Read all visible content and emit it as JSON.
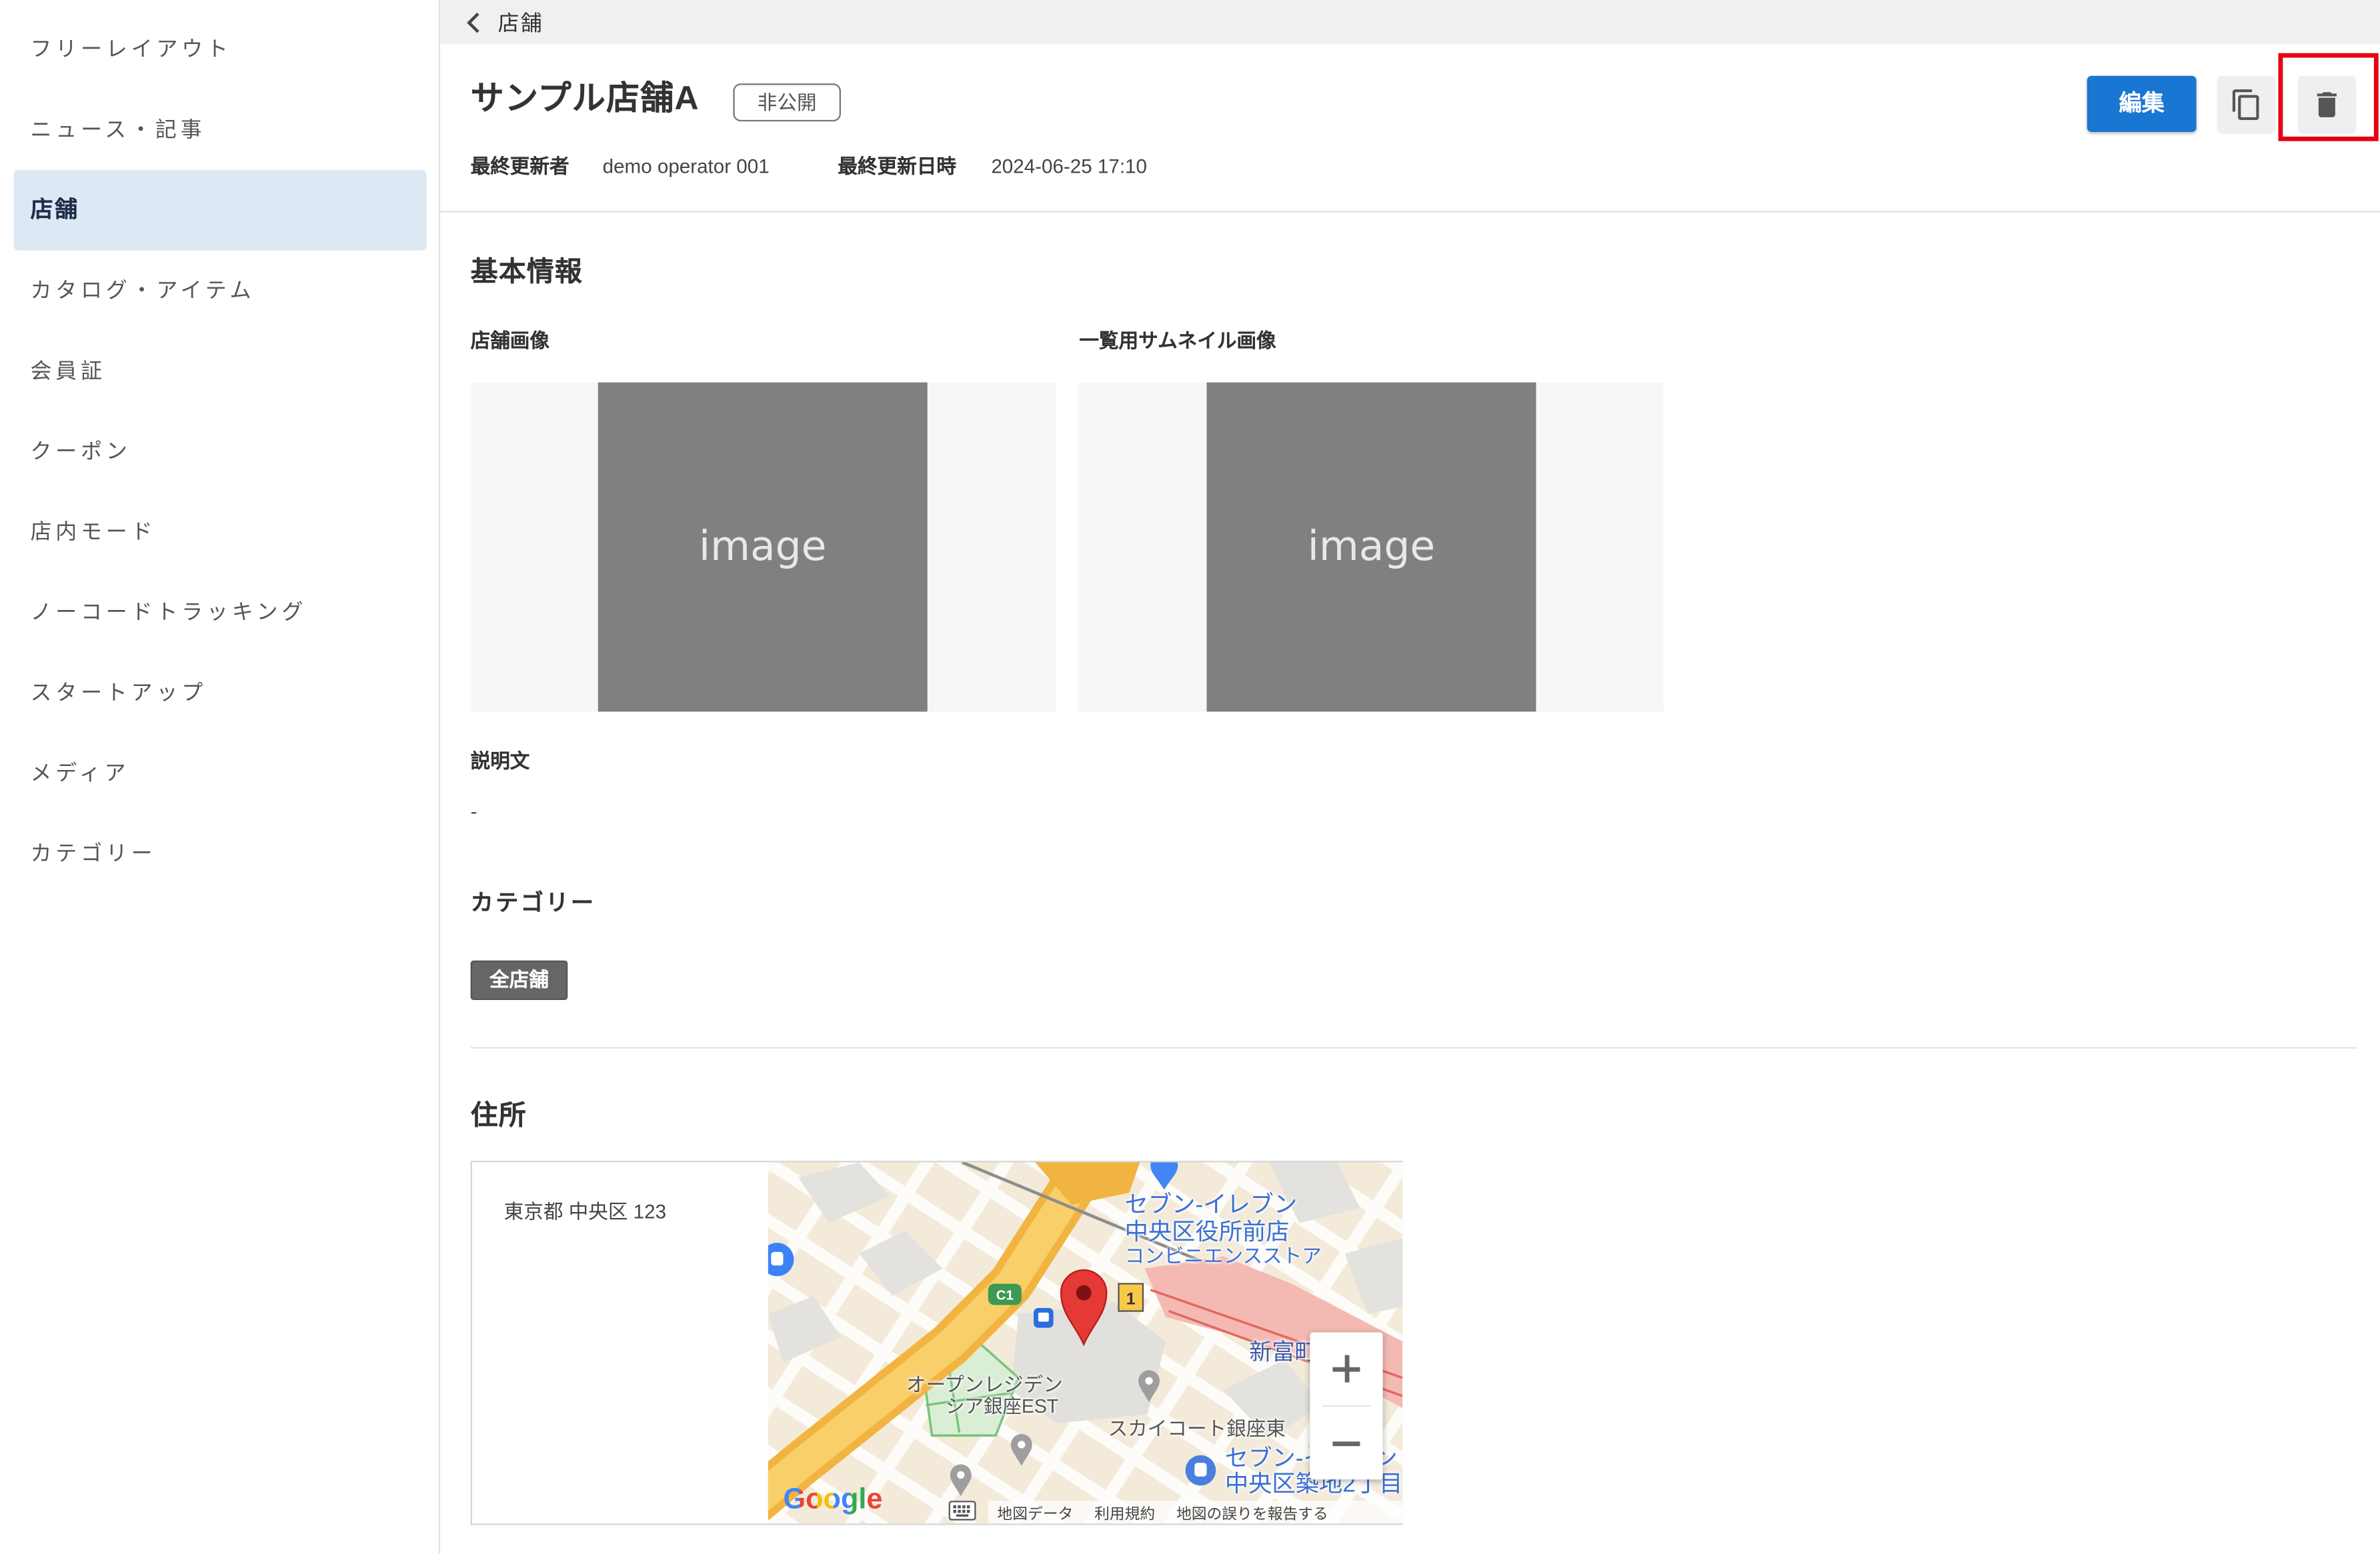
{
  "sidebar": {
    "items": [
      "フリーレイアウト",
      "ニュース・記事",
      "店舗",
      "カタログ・アイテム",
      "会員証",
      "クーポン",
      "店内モード",
      "ノーコードトラッキング",
      "スタートアップ",
      "メディア",
      "カテゴリー"
    ],
    "active_index": 2
  },
  "breadcrumb": {
    "back_label": "店舗",
    "icon": "chevron-left-icon"
  },
  "header": {
    "title": "サンプル店舗A",
    "status_badge": "非公開",
    "updated_by_label": "最終更新者",
    "updated_by": "demo operator 001",
    "updated_at_label": "最終更新日時",
    "updated_at": "2024-06-25 17:10",
    "actions": {
      "edit_label": "編集",
      "copy_icon": "copy-icon",
      "delete_icon": "trash-icon"
    }
  },
  "basic_info": {
    "heading": "基本情報",
    "store_image": {
      "label": "店舗画像",
      "placeholder": "image"
    },
    "thumbnail_image": {
      "label": "一覧用サムネイル画像",
      "placeholder": "image"
    },
    "description": {
      "label": "説明文",
      "value": "-"
    }
  },
  "category": {
    "heading": "カテゴリー",
    "tags": [
      "全店舗"
    ]
  },
  "address": {
    "heading": "住所",
    "value": "東京都 中央区 123",
    "map": {
      "labels": {
        "poi_1_name": "セブン-イレブン",
        "poi_1_branch": "中央区役所前店",
        "poi_1_type": "コンビニエンスストア",
        "station": "新富町",
        "poi_2_line1": "オープンレジデン",
        "poi_2_line2": "シア銀座EST",
        "poi_3_name": "スカイコート銀座東",
        "poi_4_name": "セブン-イレブン",
        "poi_4_branch": "中央区築地2丁目",
        "route_badge": "C1",
        "exit_badge": "1"
      },
      "attribution": {
        "logo": "Google",
        "map_data": "地図データ",
        "terms": "利用規約",
        "report": "地図の誤りを報告する"
      },
      "icons": {
        "marker": "map-pin-icon",
        "zoom_in": "plus-icon",
        "zoom_out": "minus-icon",
        "keyboard": "keyboard-icon"
      }
    }
  },
  "colors": {
    "primary": "#1976d2",
    "sidebar_active_bg": "#dde8f4",
    "highlight_border": "#e60012",
    "tag_bg": "#666666",
    "map_pin": "#e53935",
    "map_label": "#3b6fd4"
  }
}
